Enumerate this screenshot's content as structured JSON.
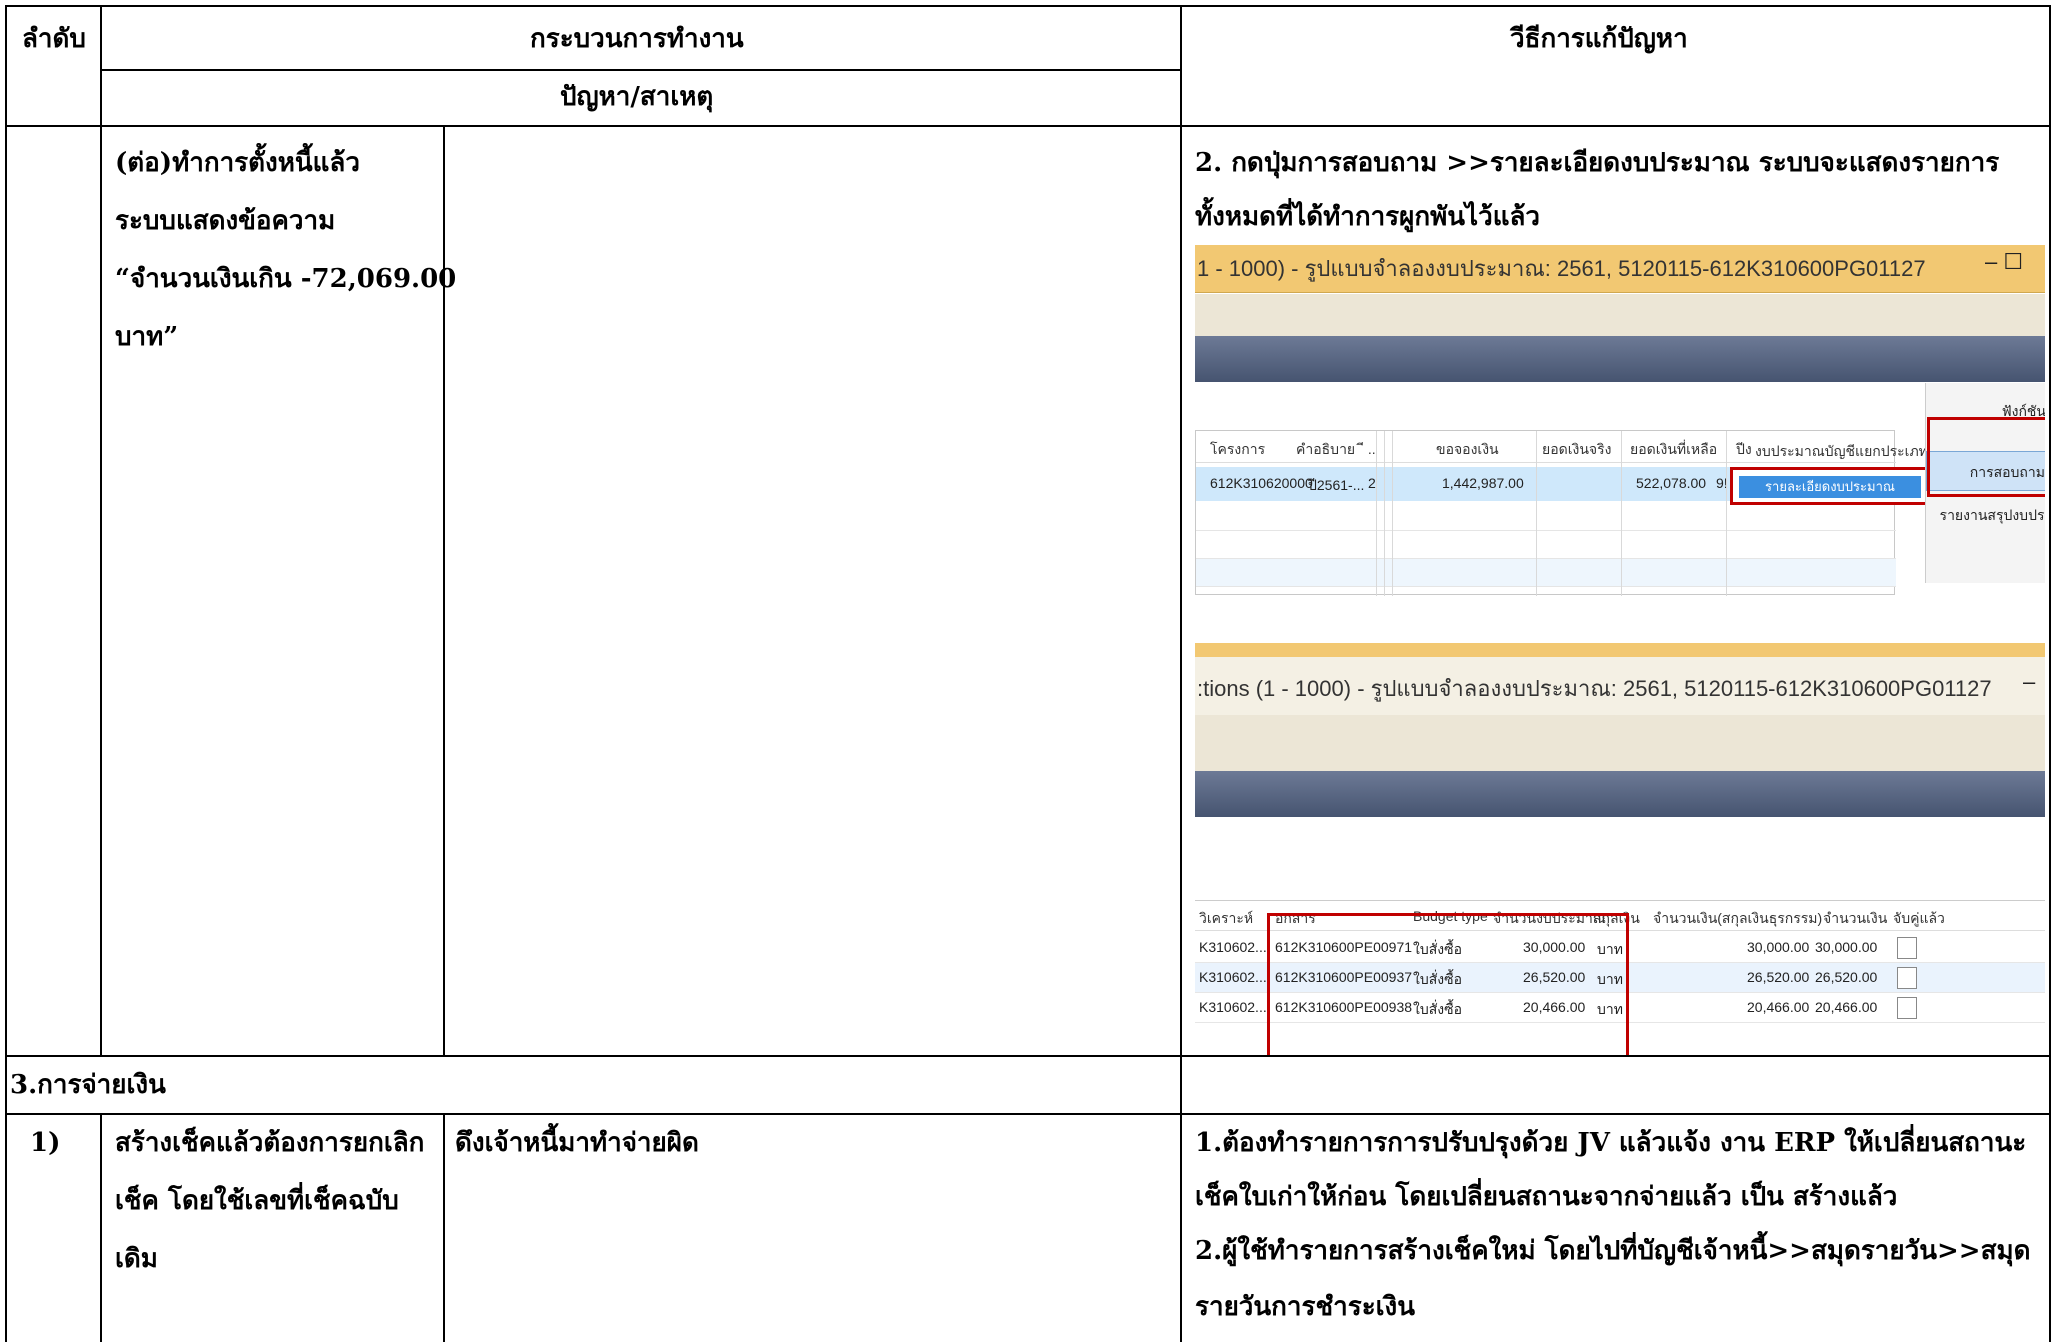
{
  "table": {
    "header": {
      "col_no": "ลำดับ",
      "col_process": "กระบวนการทำงาน",
      "col_problem": "ปัญหา/สาเหตุ",
      "col_solution": "วีธีการแก้ปัญหา"
    },
    "row_continued": {
      "process_lines": [
        "(ต่อ)ทำการตั้งหนี้แล้ว",
        "ระบบแสดงข้อความ",
        "“จำนวนเงินเกิน -72,069.00",
        "บาท”"
      ],
      "solution_lines": [
        "2. กดปุ่มการสอบถาม >>รายละเอียดงบประมาณ ระบบจะแสดงรายการ",
        "ทั้งหมดที่ได้ทำการผูกพันไว้แล้ว"
      ]
    },
    "section_3": {
      "title": "3.การจ่ายเงิน"
    },
    "row_1": {
      "no": "1)",
      "process_lines": [
        "สร้างเช็คแล้วต้องการยกเลิก",
        "เช็ค โดยใช้เลขที่เช็คฉบับ",
        "เดิม"
      ],
      "problem": "ดึงเจ้าหนี้มาทำจ่ายผิด",
      "solution_lines": [
        "1.ต้องทำรายการการปรับปรุงด้วย JV  แล้วแจ้ง งาน ERP ให้เปลี่ยนสถานะ",
        "เช็คใบเก่าให้ก่อน โดยเปลี่ยนสถานะจากจ่ายแล้ว เป็น สร้างแล้ว",
        "2.ผู้ใช้ทำรายการสร้างเช็คใหม่ โดยไปที่บัญชีเจ้าหนี้>>สมุดรายวัน>>สมุด",
        "รายวันการชำระเงิน"
      ]
    }
  },
  "screenshot": {
    "window1_title": "1 - 1000) - รูปแบบจำลองงบประมาณ: 2561, 5120115-612K310600PG01127",
    "window1_controls": "–  ☐",
    "grid1_headers": [
      "โครงการ",
      "คำอธิบาย",
      "ี ..",
      "ขอจองเงิน",
      "ยอดเงินจริง",
      "ยอดเงินที่เหลือ",
      "ปีง"
    ],
    "grid1_row": [
      "612K310620000",
      "ปี2561-...",
      "2",
      "1,442,987.00",
      "",
      "522,078.00",
      "9!"
    ],
    "popup_header": "งบประมาณบัญชีแยกประเภท",
    "popup_item": "รายละเอียดงบประมาณ",
    "side_function": "ฟังก์ชัน",
    "side_inquiry": "การสอบถาม",
    "side_report": "รายงานสรุปงบประ",
    "window2_title": ":tions (1 - 1000) - รูปแบบจำลองงบประมาณ: 2561, 5120115-612K310600PG01127",
    "window2_control": "–",
    "grid2_headers": [
      "วิเคราะห์",
      "อกสาร",
      "Budget type",
      "จำนวนงบประมาณ",
      "สกุลเงิน",
      "จำนวนเงิน(สกุลเงินธุรกรรม)",
      "จำนวนเงิน",
      "จับคู่แล้ว"
    ],
    "grid2_rows": [
      [
        "K310602...",
        "612K310600PE00971",
        "ใบสั่งซื้อ",
        "30,000.00",
        "บาท",
        "30,000.00",
        "30,000.00"
      ],
      [
        "K310602...",
        "612K310600PE00937",
        "ใบสั่งซื้อ",
        "26,520.00",
        "บาท",
        "26,520.00",
        "26,520.00"
      ],
      [
        "K310602...",
        "612K310600PE00938",
        "ใบสั่งซื้อ",
        "20,466.00",
        "บาท",
        "20,466.00",
        "20,466.00"
      ]
    ]
  }
}
